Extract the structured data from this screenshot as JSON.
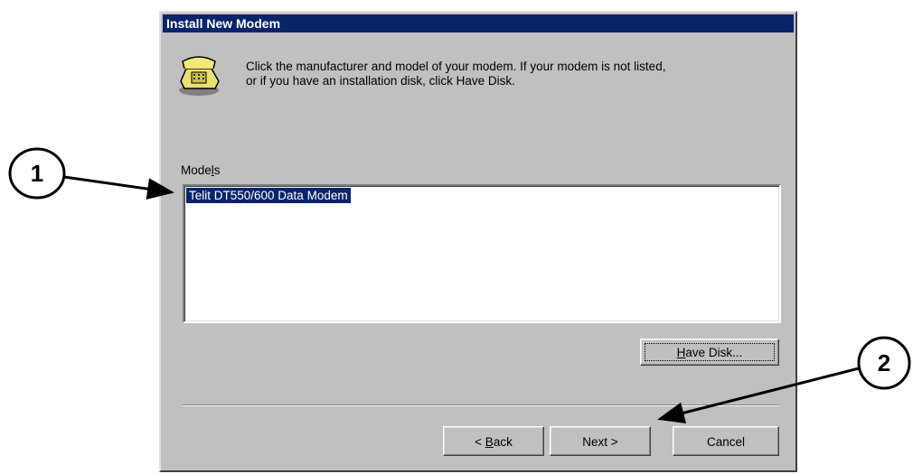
{
  "window": {
    "title": "Install New Modem"
  },
  "instructions": {
    "line1": "Click the manufacturer and model of your modem. If your modem is not listed,",
    "line2": "or if you have an installation disk, click Have Disk."
  },
  "models": {
    "label_pre": "Mode",
    "label_mnemonic": "l",
    "label_post": "s",
    "items": [
      "Telit DT550/600 Data Modem"
    ]
  },
  "buttons": {
    "have_disk_mnemonic": "H",
    "have_disk_rest": "ave Disk...",
    "back_prefix": "< ",
    "back_mnemonic": "B",
    "back_rest": "ack",
    "next": "Next >",
    "cancel": "Cancel"
  },
  "callouts": {
    "one": "1",
    "two": "2"
  },
  "icons": {
    "modem": "telephone-icon"
  },
  "colors": {
    "titlebar": "#0a246a",
    "selection": "#0a246a",
    "dialog": "#c0c0c0"
  }
}
